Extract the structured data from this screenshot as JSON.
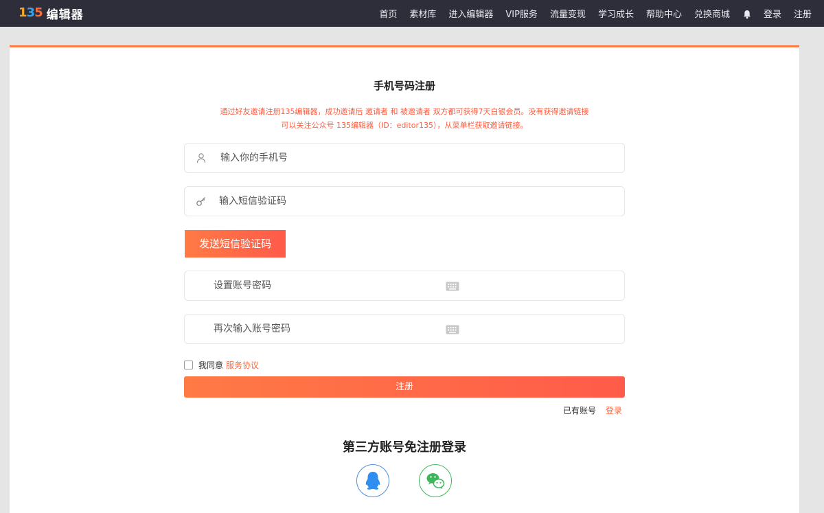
{
  "logo": {
    "mark": [
      "1",
      "3",
      "5"
    ],
    "text": "编辑器"
  },
  "nav": {
    "items": [
      "首页",
      "素材库",
      "进入编辑器",
      "VIP服务",
      "流量变现",
      "学习成长",
      "帮助中心",
      "兑换商城"
    ],
    "login": "登录",
    "register": "注册"
  },
  "form": {
    "title": "手机号码注册",
    "notice_line1": "通过好友邀请注册135编辑器，成功邀请后 邀请者 和 被邀请者 双方都可获得7天白银会员。没有获得邀请链接",
    "notice_line2": "可以关注公众号 135编辑器（ID：editor135），从菜单栏获取邀请链接。",
    "phone_placeholder": "输入你的手机号",
    "sms_placeholder": "输入短信验证码",
    "send_sms_label": "发送短信验证码",
    "password_placeholder": "设置账号密码",
    "password_confirm_placeholder": "再次输入账号密码",
    "agree_label": "我同意",
    "agreement_link": "服务协议",
    "register_label": "注册",
    "have_account": "已有账号",
    "login_link": "登录",
    "third_party_title": "第三方账号免注册登录"
  },
  "colors": {
    "accent": "#ff6a3c",
    "nav_bg": "#2d2e3a",
    "qq": "#4a90e2",
    "wechat": "#3cb85a"
  }
}
